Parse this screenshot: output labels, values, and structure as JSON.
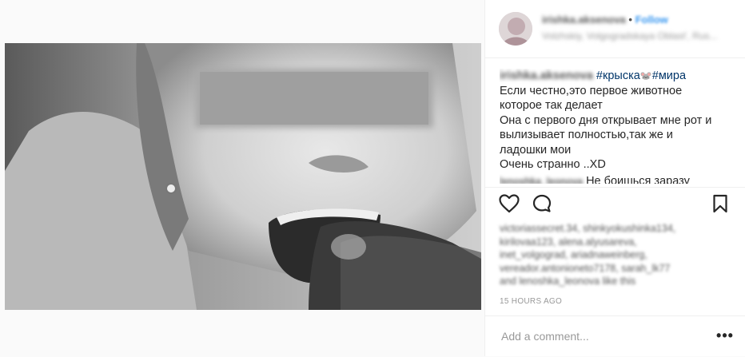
{
  "post": {
    "username": "irishka.aksenova",
    "follow_separator": "•",
    "follow_label": "Follow",
    "location": "Volzhskiy, Volgogradskaya Oblast', Rus..."
  },
  "caption": {
    "username": "irishka.aksenova",
    "hashtag_1": "#крыска",
    "emoji": "🐭",
    "hashtag_2": "#мира",
    "lines": [
      "Если честно,это первое животное",
      "которое так делает",
      "Она с первого дня открывает мне рот и",
      "вылизывает полностью,так же и",
      "ладошки мои",
      "Очень странно ..XD"
    ]
  },
  "comment": {
    "username": "lenoshka_leonova",
    "text": "Не боишься заразу"
  },
  "likes": {
    "lines": [
      "victoriassecret.34, shinkyokushinka134,",
      "kirilovaa123, alena.alyusareva,",
      "inet_volgograd, ariadnaweinberg,",
      "vereador.antonioneto7178, sarah_lk77",
      "and lenoshka_leonova like this"
    ]
  },
  "timestamp": "15 HOURS AGO",
  "add_comment": {
    "placeholder": "Add a comment..."
  },
  "more_label": "•••",
  "icons": {
    "like": "heart-icon",
    "comment": "comment-icon",
    "save": "bookmark-icon",
    "tagged": "person-tag-icon"
  },
  "colors": {
    "link_blue": "#3897f0",
    "hashtag": "#003569",
    "muted": "#999999"
  }
}
